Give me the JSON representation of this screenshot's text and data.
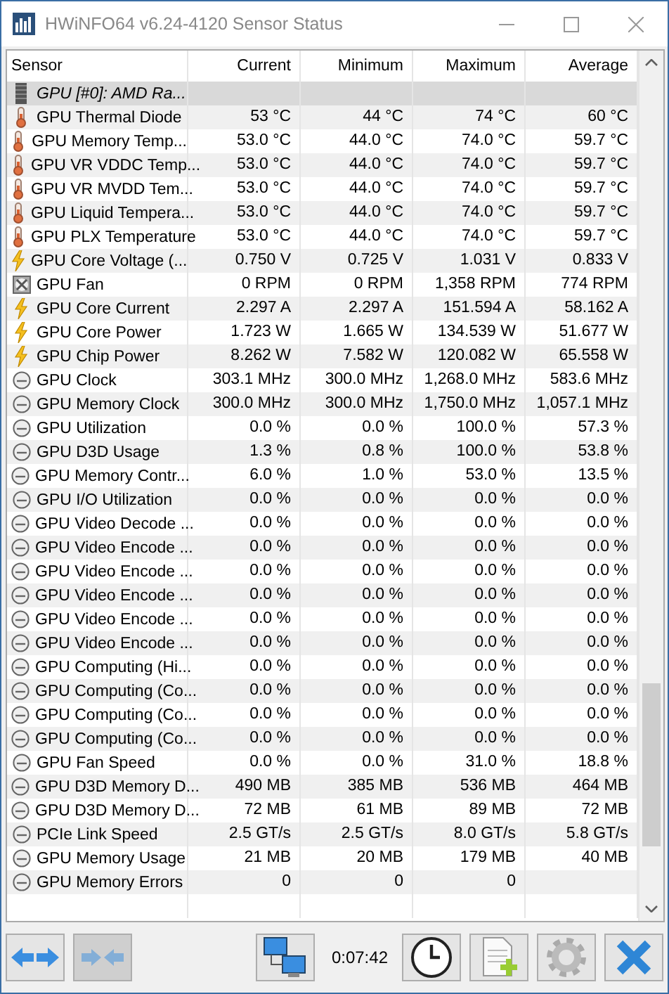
{
  "window": {
    "title": "HWiNFO64 v6.24-4120 Sensor Status"
  },
  "table": {
    "columns": [
      "Sensor",
      "Current",
      "Minimum",
      "Maximum",
      "Average"
    ],
    "group": {
      "label": "GPU [#0]: AMD Ra..."
    },
    "rows": [
      {
        "kind": "temp",
        "name": "GPU Thermal Diode",
        "current": "53 °C",
        "minimum": "44 °C",
        "maximum": "74 °C",
        "average": "60 °C"
      },
      {
        "kind": "temp",
        "name": "GPU Memory Temp...",
        "current": "53.0 °C",
        "minimum": "44.0 °C",
        "maximum": "74.0 °C",
        "average": "59.7 °C"
      },
      {
        "kind": "temp",
        "name": "GPU VR VDDC Temp...",
        "current": "53.0 °C",
        "minimum": "44.0 °C",
        "maximum": "74.0 °C",
        "average": "59.7 °C"
      },
      {
        "kind": "temp",
        "name": "GPU VR MVDD Tem...",
        "current": "53.0 °C",
        "minimum": "44.0 °C",
        "maximum": "74.0 °C",
        "average": "59.7 °C"
      },
      {
        "kind": "temp",
        "name": "GPU Liquid Tempera...",
        "current": "53.0 °C",
        "minimum": "44.0 °C",
        "maximum": "74.0 °C",
        "average": "59.7 °C"
      },
      {
        "kind": "temp",
        "name": "GPU PLX Temperature",
        "current": "53.0 °C",
        "minimum": "44.0 °C",
        "maximum": "74.0 °C",
        "average": "59.7 °C"
      },
      {
        "kind": "power",
        "name": "GPU Core Voltage (...",
        "current": "0.750 V",
        "minimum": "0.725 V",
        "maximum": "1.031 V",
        "average": "0.833 V"
      },
      {
        "kind": "fan",
        "name": "GPU Fan",
        "current": "0 RPM",
        "minimum": "0 RPM",
        "maximum": "1,358 RPM",
        "average": "774 RPM"
      },
      {
        "kind": "power",
        "name": "GPU Core Current",
        "current": "2.297 A",
        "minimum": "2.297 A",
        "maximum": "151.594 A",
        "average": "58.162 A"
      },
      {
        "kind": "power",
        "name": "GPU Core Power",
        "current": "1.723 W",
        "minimum": "1.665 W",
        "maximum": "134.539 W",
        "average": "51.677 W"
      },
      {
        "kind": "power",
        "name": "GPU Chip Power",
        "current": "8.262 W",
        "minimum": "7.582 W",
        "maximum": "120.082 W",
        "average": "65.558 W"
      },
      {
        "kind": "gauge",
        "name": "GPU Clock",
        "current": "303.1 MHz",
        "minimum": "300.0 MHz",
        "maximum": "1,268.0 MHz",
        "average": "583.6 MHz"
      },
      {
        "kind": "gauge",
        "name": "GPU Memory Clock",
        "current": "300.0 MHz",
        "minimum": "300.0 MHz",
        "maximum": "1,750.0 MHz",
        "average": "1,057.1 MHz"
      },
      {
        "kind": "gauge",
        "name": "GPU Utilization",
        "current": "0.0 %",
        "minimum": "0.0 %",
        "maximum": "100.0 %",
        "average": "57.3 %"
      },
      {
        "kind": "gauge",
        "name": "GPU D3D Usage",
        "current": "1.3 %",
        "minimum": "0.8 %",
        "maximum": "100.0 %",
        "average": "53.8 %"
      },
      {
        "kind": "gauge",
        "name": "GPU Memory Contr...",
        "current": "6.0 %",
        "minimum": "1.0 %",
        "maximum": "53.0 %",
        "average": "13.5 %"
      },
      {
        "kind": "gauge",
        "name": "GPU I/O Utilization",
        "current": "0.0 %",
        "minimum": "0.0 %",
        "maximum": "0.0 %",
        "average": "0.0 %"
      },
      {
        "kind": "gauge",
        "name": "GPU Video Decode ...",
        "current": "0.0 %",
        "minimum": "0.0 %",
        "maximum": "0.0 %",
        "average": "0.0 %"
      },
      {
        "kind": "gauge",
        "name": "GPU Video Encode ...",
        "current": "0.0 %",
        "minimum": "0.0 %",
        "maximum": "0.0 %",
        "average": "0.0 %"
      },
      {
        "kind": "gauge",
        "name": "GPU Video Encode ...",
        "current": "0.0 %",
        "minimum": "0.0 %",
        "maximum": "0.0 %",
        "average": "0.0 %"
      },
      {
        "kind": "gauge",
        "name": "GPU Video Encode ...",
        "current": "0.0 %",
        "minimum": "0.0 %",
        "maximum": "0.0 %",
        "average": "0.0 %"
      },
      {
        "kind": "gauge",
        "name": "GPU Video Encode ...",
        "current": "0.0 %",
        "minimum": "0.0 %",
        "maximum": "0.0 %",
        "average": "0.0 %"
      },
      {
        "kind": "gauge",
        "name": "GPU Video Encode ...",
        "current": "0.0 %",
        "minimum": "0.0 %",
        "maximum": "0.0 %",
        "average": "0.0 %"
      },
      {
        "kind": "gauge",
        "name": "GPU Computing (Hi...",
        "current": "0.0 %",
        "minimum": "0.0 %",
        "maximum": "0.0 %",
        "average": "0.0 %"
      },
      {
        "kind": "gauge",
        "name": "GPU Computing (Co...",
        "current": "0.0 %",
        "minimum": "0.0 %",
        "maximum": "0.0 %",
        "average": "0.0 %"
      },
      {
        "kind": "gauge",
        "name": "GPU Computing (Co...",
        "current": "0.0 %",
        "minimum": "0.0 %",
        "maximum": "0.0 %",
        "average": "0.0 %"
      },
      {
        "kind": "gauge",
        "name": "GPU Computing (Co...",
        "current": "0.0 %",
        "minimum": "0.0 %",
        "maximum": "0.0 %",
        "average": "0.0 %"
      },
      {
        "kind": "gauge",
        "name": "GPU Fan Speed",
        "current": "0.0 %",
        "minimum": "0.0 %",
        "maximum": "31.0 %",
        "average": "18.8 %"
      },
      {
        "kind": "gauge",
        "name": "GPU D3D Memory D...",
        "current": "490 MB",
        "minimum": "385 MB",
        "maximum": "536 MB",
        "average": "464 MB"
      },
      {
        "kind": "gauge",
        "name": "GPU D3D Memory D...",
        "current": "72 MB",
        "minimum": "61 MB",
        "maximum": "89 MB",
        "average": "72 MB"
      },
      {
        "kind": "gauge",
        "name": "PCIe Link Speed",
        "current": "2.5 GT/s",
        "minimum": "2.5 GT/s",
        "maximum": "8.0 GT/s",
        "average": "5.8 GT/s"
      },
      {
        "kind": "gauge",
        "name": "GPU Memory Usage",
        "current": "21 MB",
        "minimum": "20 MB",
        "maximum": "179 MB",
        "average": "40 MB"
      },
      {
        "kind": "gauge",
        "name": "GPU Memory Errors",
        "current": "0",
        "minimum": "0",
        "maximum": "0"
      }
    ]
  },
  "toolbar": {
    "collapse_disabled": true,
    "elapsed": "0:07:42"
  }
}
